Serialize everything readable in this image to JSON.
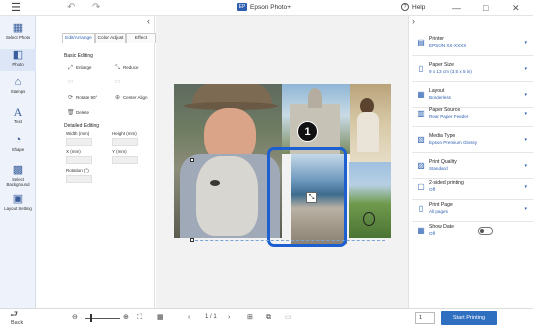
{
  "titlebar": {
    "title": "Epson Photo+",
    "logo_text": "EP",
    "help": "Help",
    "help_icon": "?",
    "undo_glyph": "↶",
    "redo_glyph": "↷",
    "minimize_glyph": "—",
    "maximize_glyph": "□",
    "close_glyph": "✕",
    "menu_glyph": "☰"
  },
  "left_nav": {
    "items": [
      {
        "label": "Select Photo",
        "icon": "photo-icon",
        "glyph": "▦"
      },
      {
        "label": "Photo",
        "icon": "layers-icon",
        "glyph": "◧"
      },
      {
        "label": "Stamps",
        "icon": "stamp-icon",
        "glyph": "⌂"
      },
      {
        "label": "Text",
        "icon": "text-icon",
        "glyph": "A"
      },
      {
        "label": "Shape",
        "icon": "shape-icon",
        "glyph": "◔"
      },
      {
        "label": "Select Background",
        "icon": "background-icon",
        "glyph": "▩"
      },
      {
        "label": "Layout Setting",
        "icon": "layout-setting-icon",
        "glyph": "▣"
      }
    ]
  },
  "edit_panel": {
    "collapse_glyph": "‹",
    "tabs": [
      "Edit/Arrange",
      "Color Adjust",
      "Effect"
    ],
    "basic_title": "Basic Editing",
    "buttons": [
      {
        "label": "Enlarge",
        "glyph": "⤢",
        "disabled": false
      },
      {
        "label": "Reduce",
        "glyph": "⤡",
        "disabled": false
      },
      {
        "label": "",
        "glyph": "▭",
        "disabled": true
      },
      {
        "label": "",
        "glyph": "▭",
        "disabled": true
      },
      {
        "label": "Rotate 90°",
        "glyph": "⟳",
        "disabled": false
      },
      {
        "label": "Center Align",
        "glyph": "⊕",
        "disabled": false
      },
      {
        "label": "Delete",
        "glyph": "🗑",
        "disabled": false
      }
    ],
    "detail_title": "Detailed Editing",
    "fields": [
      "Width (mm)",
      "Height (mm)",
      "X (mm)",
      "Y (mm)",
      "Rotation (°)"
    ]
  },
  "canvas": {
    "badge": "1",
    "resize_icon": "⤡"
  },
  "settings_panel": {
    "collapse_glyph": "›",
    "items": [
      {
        "title": "Printer",
        "value": "EPSON XX-XXXX",
        "icon": "printer-icon",
        "glyph": "▤"
      },
      {
        "title": "Paper Size",
        "value": "9 x 13 cm (3.5 x 5 in)",
        "icon": "paper-size-icon",
        "glyph": "▯"
      },
      {
        "title": "Layout",
        "value": "Borderless",
        "icon": "layout-icon",
        "glyph": "▦"
      },
      {
        "title": "Paper Source",
        "value": "Rear Paper Feeder",
        "icon": "paper-source-icon",
        "glyph": "▥"
      },
      {
        "title": "Media Type",
        "value": "Epson Premium Glossy",
        "icon": "media-type-icon",
        "glyph": "▧"
      },
      {
        "title": "Print Quality",
        "value": "Standard",
        "icon": "print-quality-icon",
        "glyph": "▨"
      },
      {
        "title": "2-sided printing",
        "value": "Off",
        "icon": "two-sided-icon",
        "glyph": "▢"
      },
      {
        "title": "Print Page",
        "value": "All pages",
        "icon": "print-page-icon",
        "glyph": "▯"
      },
      {
        "title": "Show Date",
        "value": "Off",
        "icon": "calendar-icon",
        "glyph": "▦"
      }
    ],
    "dropdown_glyph": "▾",
    "show_date_on": false
  },
  "bottom": {
    "back_label": "Back",
    "back_glyph": "⮐",
    "zoom_out_glyph": "⊖",
    "zoom_in_glyph": "⊕",
    "fit_glyph": "⛶",
    "actual_glyph": "⛶",
    "grid_glyph": "▦",
    "prev_glyph": "‹",
    "next_glyph": "›",
    "page_indicator": "1 / 1",
    "add_page_glyph": "⊞",
    "copy_page_glyph": "⧉",
    "delete_page_glyph": "▭",
    "copies": "1",
    "start_printing": "Start Printing"
  }
}
